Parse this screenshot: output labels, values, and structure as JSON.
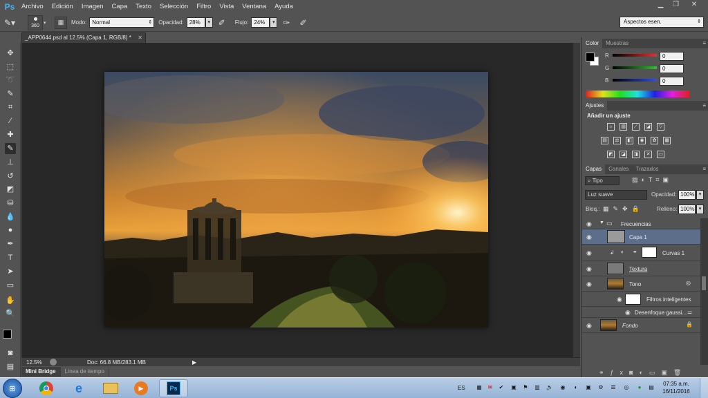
{
  "app": {
    "logo": "Ps"
  },
  "menu": [
    "Archivo",
    "Edición",
    "Imagen",
    "Capa",
    "Texto",
    "Selección",
    "Filtro",
    "Vista",
    "Ventana",
    "Ayuda"
  ],
  "options": {
    "brush_size": "360",
    "mode_label": "Modo:",
    "mode_value": "Normal",
    "opacity_label": "Opacidad:",
    "opacity_value": "28%",
    "flow_label": "Flujo:",
    "flow_value": "24%",
    "workspace": "Aspectos esen."
  },
  "document": {
    "tab_title": "_APP0644.psd al 12.5% (Capa 1, RGB/8) *",
    "zoom": "12.5%",
    "doc_info": "Doc: 66.8 MB/283.1 MB"
  },
  "bottom_tabs": [
    "Mini Bridge",
    "Línea de tiempo"
  ],
  "color_panel": {
    "tabs": [
      "Color",
      "Muestras"
    ],
    "channels": [
      {
        "label": "R",
        "value": "0",
        "color": "#e83030"
      },
      {
        "label": "G",
        "value": "0",
        "color": "#30c030"
      },
      {
        "label": "B",
        "value": "0",
        "color": "#3050e0"
      }
    ]
  },
  "adjust_panel": {
    "tab": "Ajustes",
    "heading": "Añadir un ajuste"
  },
  "layers_panel": {
    "tabs": [
      "Capas",
      "Canales",
      "Trazados"
    ],
    "filter": "Tipo",
    "blend_mode": "Luz suave",
    "opacity_label": "Opacidad:",
    "opacity_value": "100%",
    "lock_label": "Bloq.:",
    "fill_label": "Relleno:",
    "fill_value": "100%",
    "layers": [
      {
        "name": "Frecuencias"
      },
      {
        "name": "Capa 1"
      },
      {
        "name": "Curvas 1"
      },
      {
        "name": "Textura"
      },
      {
        "name": "Tono"
      },
      {
        "name": "Filtros inteligentes"
      },
      {
        "name": "Desenfoque gaussi..."
      },
      {
        "name": "Fondo"
      }
    ]
  },
  "taskbar": {
    "lang": "ES",
    "time": "07:35 a.m.",
    "date": "16/11/2016",
    "ps_label": "Ps"
  }
}
